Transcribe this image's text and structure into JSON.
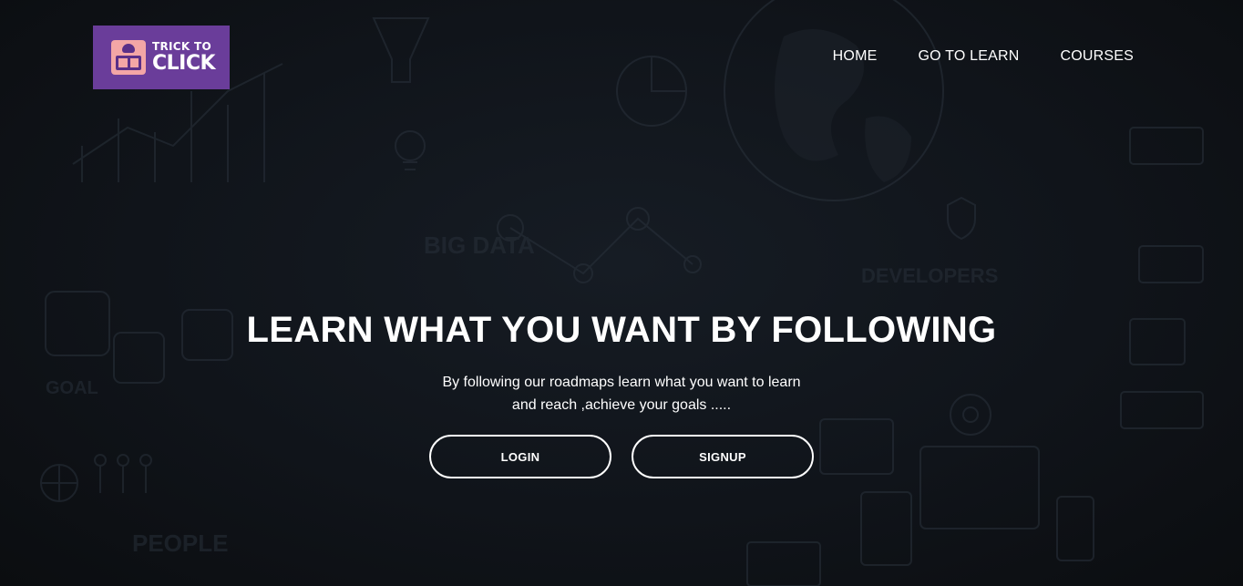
{
  "brand": {
    "line1": "TRICK TO",
    "line2": "CLICK",
    "color": "#6a3d9a"
  },
  "nav": {
    "items": [
      {
        "label": "HOME"
      },
      {
        "label": "GO TO LEARN"
      },
      {
        "label": "COURSES"
      }
    ]
  },
  "hero": {
    "title": "LEARN WHAT YOU WANT BY FOLLOWING",
    "subtitle_line1": "By following our roadmaps learn what you want to learn",
    "subtitle_line2": "and reach ,achieve your goals .....",
    "login_label": "LOGIN",
    "signup_label": "SIGNUP"
  },
  "colors": {
    "background": "#0d1014",
    "text": "#ffffff",
    "button_border": "#ffffff"
  },
  "background_art": {
    "decorative_labels": [
      "BIG DATA",
      "DEVELOPERS",
      "PEOPLE",
      "GOAL"
    ]
  }
}
